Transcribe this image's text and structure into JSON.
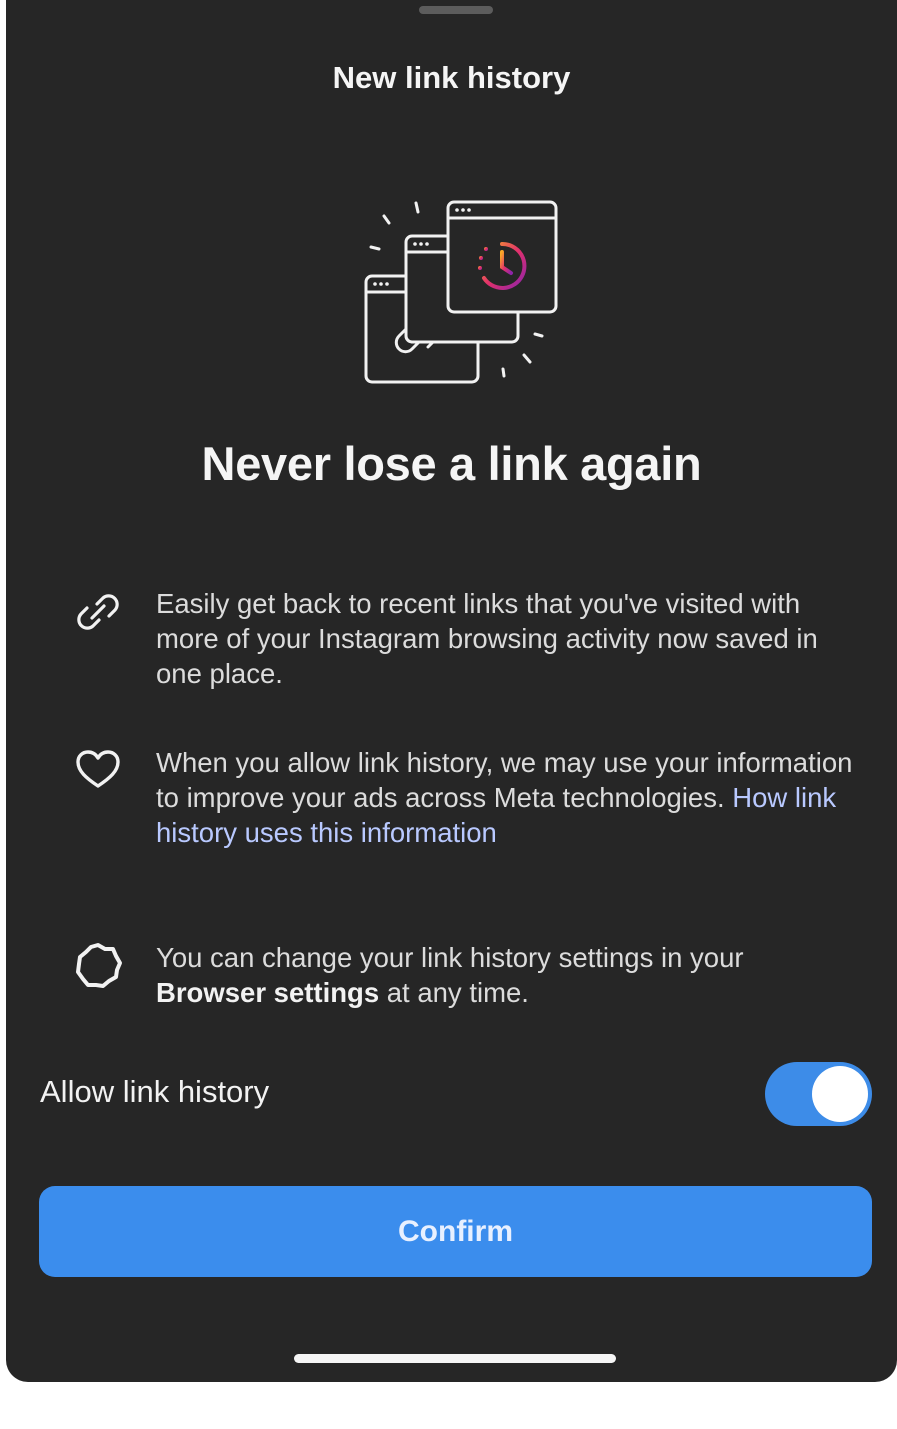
{
  "sheet": {
    "title": "New link history"
  },
  "hero": {
    "headline": "Never lose a link again"
  },
  "info_items": [
    {
      "icon": "link-icon",
      "text": "Easily get back to recent links that you've visited with more of your Instagram browsing activity now saved in one place."
    },
    {
      "icon": "heart-icon",
      "text": "When you allow link history, we may use your information to improve your ads across Meta technologies.",
      "link_text": "How link history uses this information"
    },
    {
      "icon": "gear-icon",
      "text_before": "You can change your link history settings in your",
      "bold_text": "Browser settings",
      "text_after": "at any time."
    }
  ],
  "toggle": {
    "label": "Allow link history",
    "enabled": true
  },
  "confirm_button": {
    "label": "Confirm"
  },
  "colors": {
    "sheet_background": "#262626",
    "accent_blue": "#3b8ded",
    "link_text": "#b9c9ff"
  }
}
